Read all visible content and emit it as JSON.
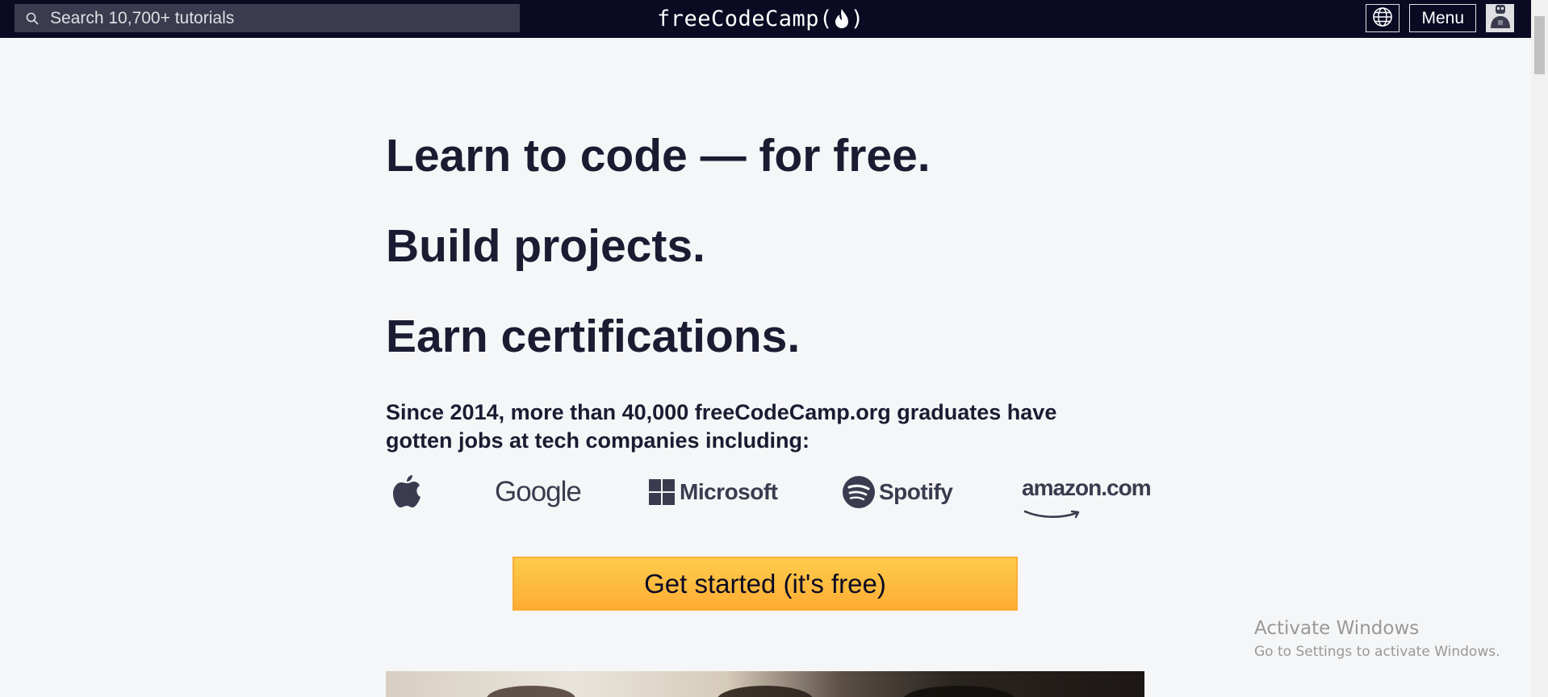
{
  "navbar": {
    "search": {
      "placeholder": "Search 10,700+ tutorials",
      "value": ""
    },
    "logo": {
      "prefix": "freeCodeCamp(",
      "suffix": ")"
    },
    "menu_label": "Menu"
  },
  "hero": {
    "headline_1": "Learn to code — for free.",
    "headline_2": "Build projects.",
    "headline_3": "Earn certifications.",
    "subtext": "Since 2014, more than 40,000 freeCodeCamp.org graduates have gotten jobs at tech companies including:",
    "companies": {
      "google": "Google",
      "microsoft": "Microsoft",
      "spotify": "Spotify",
      "amazon": "amazon.com"
    },
    "cta_label": "Get started (it's free)"
  },
  "watermark": {
    "title": "Activate Windows",
    "subtitle": "Go to Settings to activate Windows."
  },
  "colors": {
    "navbar_bg": "#0a0a23",
    "search_bg": "#3b3b4f",
    "page_bg": "#f5f6f7",
    "text_dark": "#1b1b32",
    "cta_top": "#fecc4c",
    "cta_bottom": "#ffac33"
  }
}
